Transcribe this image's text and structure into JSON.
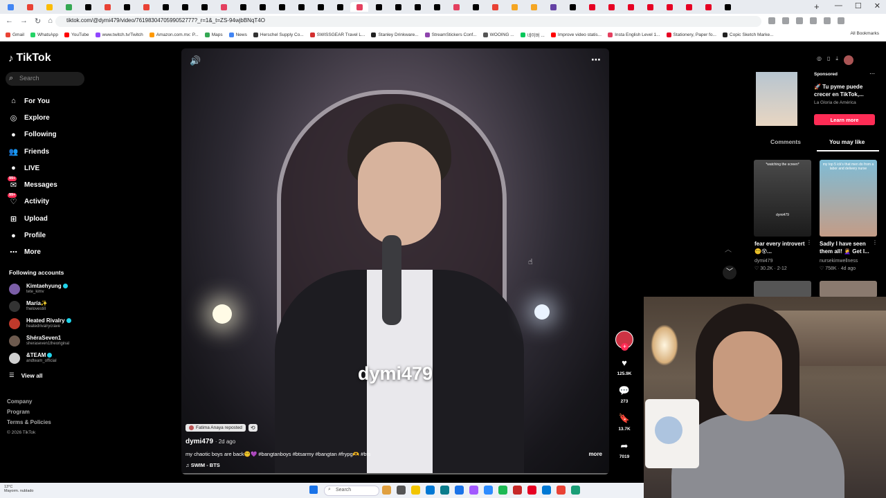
{
  "browser": {
    "tab_colors": [
      "#4285f4",
      "#e94235",
      "#fbbc04",
      "#34a853",
      "#000000",
      "#e94235",
      "#000000",
      "#e94235",
      "#000000",
      "#000000",
      "#000000",
      "#e4405f",
      "#000000",
      "#000000",
      "#000000",
      "#000000",
      "#000000",
      "#000000",
      "#e4405f",
      "#000000",
      "#000000",
      "#000000",
      "#000000",
      "#e4405f",
      "#000000",
      "#e94235",
      "#f5a623",
      "#f5a623",
      "#6441a5",
      "#000000",
      "#e60023",
      "#e60023",
      "#e60023",
      "#e60023",
      "#e60023",
      "#e60023",
      "#e60023",
      "#000000"
    ],
    "url": "tiktok.com/@dymi479/video/7619830470599052777?_r=1&_t=ZS-94wjbBNqT4O",
    "bookmarks": [
      {
        "label": "Gmail",
        "color": "#ea4335"
      },
      {
        "label": "WhatsApp",
        "color": "#25d366"
      },
      {
        "label": "YouTube",
        "color": "#ff0000"
      },
      {
        "label": "www.twitch.tv/Twitch",
        "color": "#9146ff"
      },
      {
        "label": "Amazon.com.mx: P...",
        "color": "#ff9900"
      },
      {
        "label": "Maps",
        "color": "#34a853"
      },
      {
        "label": "News",
        "color": "#4285f4"
      },
      {
        "label": "Herschel Supply Co...",
        "color": "#333333"
      },
      {
        "label": "SWISSGEAR Travel L...",
        "color": "#d32f2f"
      },
      {
        "label": "Stanley Drinkware...",
        "color": "#222222"
      },
      {
        "label": "StreamStickers Conf...",
        "color": "#8e44ad"
      },
      {
        "label": "WOOING ...",
        "color": "#555555"
      },
      {
        "label": "네이버 ...",
        "color": "#03c75a"
      },
      {
        "label": "Improve video statis...",
        "color": "#ff0000"
      },
      {
        "label": "Insta English Level 1...",
        "color": "#e4405f"
      },
      {
        "label": "Stationery, Paper fo...",
        "color": "#e60023"
      },
      {
        "label": "Copic Sketch Marke...",
        "color": "#222222"
      }
    ],
    "all_bookmarks": "All Bookmarks"
  },
  "sidebar": {
    "logo": "TikTok",
    "search_placeholder": "Search",
    "nav": [
      {
        "label": "For You",
        "icon": "⌂",
        "name": "home-icon"
      },
      {
        "label": "Explore",
        "icon": "◎",
        "name": "compass-icon"
      },
      {
        "label": "Following",
        "icon": "●",
        "name": "following-icon"
      },
      {
        "label": "Friends",
        "icon": "👥",
        "name": "friends-icon"
      },
      {
        "label": "LIVE",
        "icon": "●",
        "name": "live-icon"
      },
      {
        "label": "Messages",
        "icon": "✉",
        "name": "messages-icon",
        "badge": "99+"
      },
      {
        "label": "Activity",
        "icon": "♡",
        "name": "activity-icon",
        "badge": "99+"
      },
      {
        "label": "Upload",
        "icon": "⊞",
        "name": "upload-icon"
      },
      {
        "label": "Profile",
        "icon": "●",
        "name": "profile-icon"
      },
      {
        "label": "More",
        "icon": "⋯",
        "name": "more-icon"
      }
    ],
    "following_heading": "Following accounts",
    "accounts": [
      {
        "name": "Kimtaehyung",
        "handle": "tete_kimv",
        "verified": true,
        "color": "#7b5ea7"
      },
      {
        "name": "María",
        "handle": "fnelovestill",
        "verified": false,
        "color": "#333333",
        "emoji": "✨"
      },
      {
        "name": "Heated Rivalry",
        "handle": "heatedrivalrycrave",
        "verified": true,
        "color": "#c0392b"
      },
      {
        "name": "ShéraSeven1",
        "handle": "sheraseven1theoriginal",
        "verified": false,
        "color": "#6d5a4e"
      },
      {
        "name": "&TEAM",
        "handle": "andteam_official",
        "verified": true,
        "color": "#cfcfcf"
      }
    ],
    "view_all": "View all",
    "footer": [
      "Company",
      "Program",
      "Terms & Policies"
    ],
    "copyright": "© 2026 TikTok"
  },
  "video": {
    "overlay_text": "dymi479",
    "reposted_by": "Fatima Anaya reposted",
    "author": "dymi479",
    "posted_ago": "· 2d ago",
    "caption": "my chaotic boys are back😵‍💫💜 #bangtanboys #btsarmy #bangtan #frypg🫶 #bts",
    "more": "more",
    "music": "♫  SWIM - BTS"
  },
  "actions": {
    "likes": "125.9K",
    "comments": "273",
    "saves": "13.7K",
    "shares": "7019"
  },
  "right_panel": {
    "sponsored": "Sponsored",
    "ad_title": "🚀 Tu pyme puede crecer en TikTok,...",
    "ad_advertiser": "La Gloria de América",
    "learn_more": "Learn more",
    "tabs": [
      "Comments",
      "You may like"
    ],
    "recommended": [
      {
        "overlay": "*watching the screen*",
        "name_tag": "dymi479",
        "title": "fear every introvert😵‍💫😵...",
        "user": "dymi479",
        "stats": "♡ 30.2K · 2-12"
      },
      {
        "overlay": "my top 5 ick's that men do from a labor and delivery nurse",
        "name_tag": "",
        "title": "Sadly I have seen them all! 🤦‍♀️ Get I...",
        "user": "nursekimwellness",
        "stats": "♡ 758K · 4d ago"
      }
    ]
  },
  "taskbar": {
    "weather": "13°C\nMayorm. nublado",
    "search": "Search",
    "app_colors": [
      "#e0a040",
      "#555555",
      "#f2c500",
      "#0078d4",
      "#0a7c8c",
      "#1a73e8",
      "#a259ff",
      "#2d8cff",
      "#1db954",
      "#c62828",
      "#e60023",
      "#0078d4",
      "#e94235",
      "#1b9e77"
    ]
  }
}
